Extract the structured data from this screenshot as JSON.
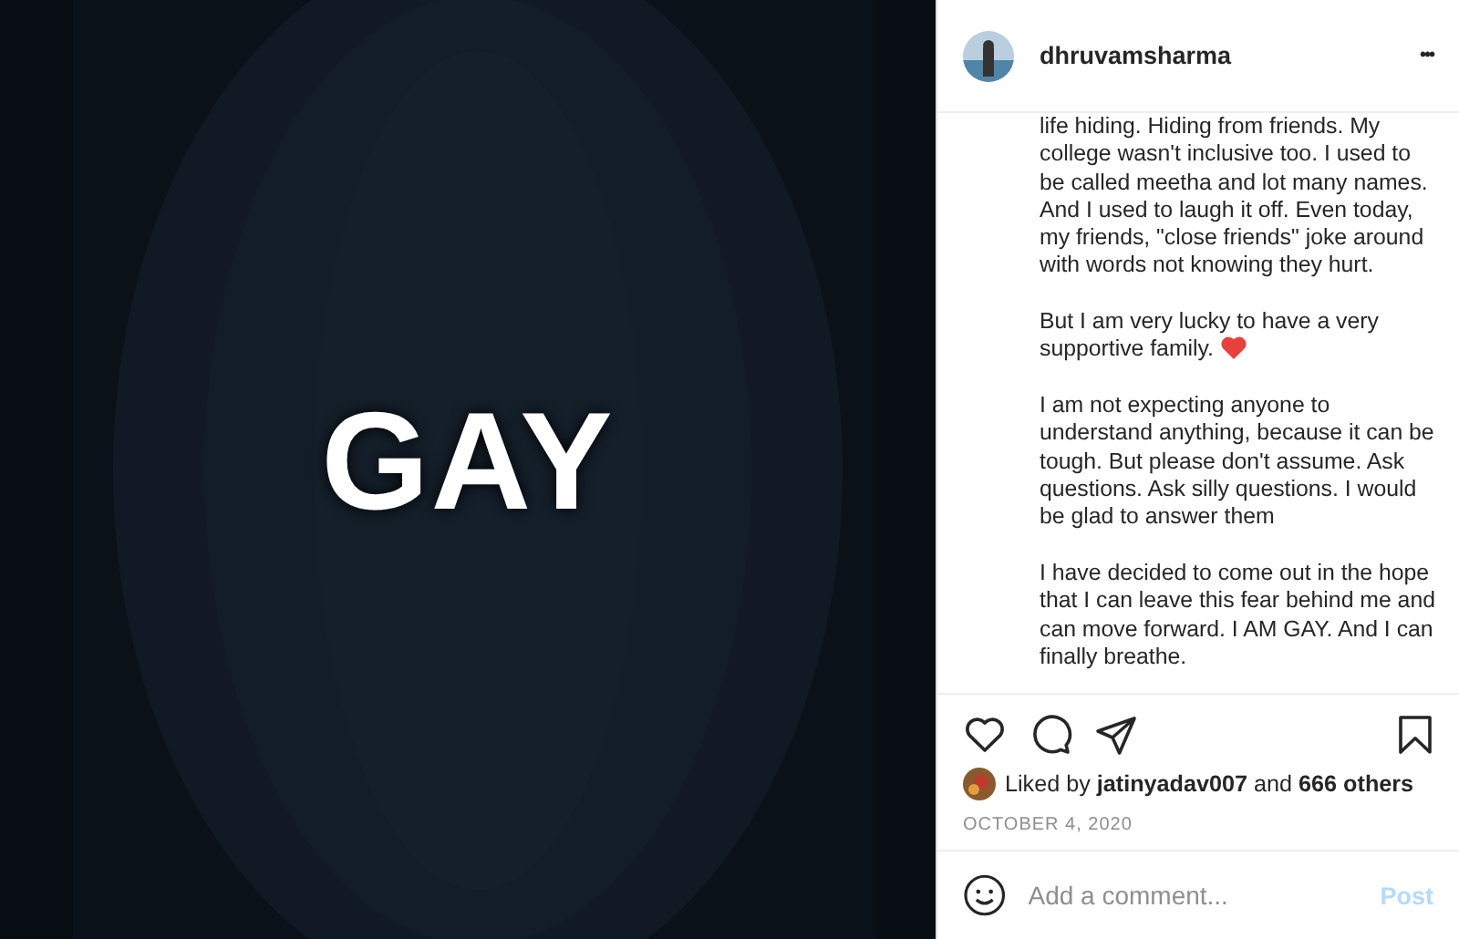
{
  "post_image": {
    "overlay_text": "GAY"
  },
  "header": {
    "username": "dhruvamsharma",
    "more": "•••"
  },
  "caption": [
    {
      "text": "life hiding. Hiding from friends. My college wasn't inclusive too. I used to be called meetha and lot many names. And I used to laugh it off. Even today, my friends, \"close friends\" joke around with words not knowing they hurt."
    },
    {
      "text": "But I am very lucky to have a very supportive family.",
      "heart": true
    },
    {
      "text": "I am not expecting anyone to understand anything, because it can be tough. But please don't assume. Ask questions. Ask silly questions. I would be glad to answer them"
    },
    {
      "text": "I have decided to come out in the hope that I can leave this fear behind me and can move forward. I AM GAY. And I can finally breathe."
    }
  ],
  "actions": {
    "liked": false,
    "saved": false
  },
  "likes": "Liked by **jatinyadav007** and **666 others**",
  "date": "OCTOBER 4, 2020",
  "comment": {
    "placeholder": "Add a comment...",
    "post": "Post",
    "post_disabled": true
  }
}
